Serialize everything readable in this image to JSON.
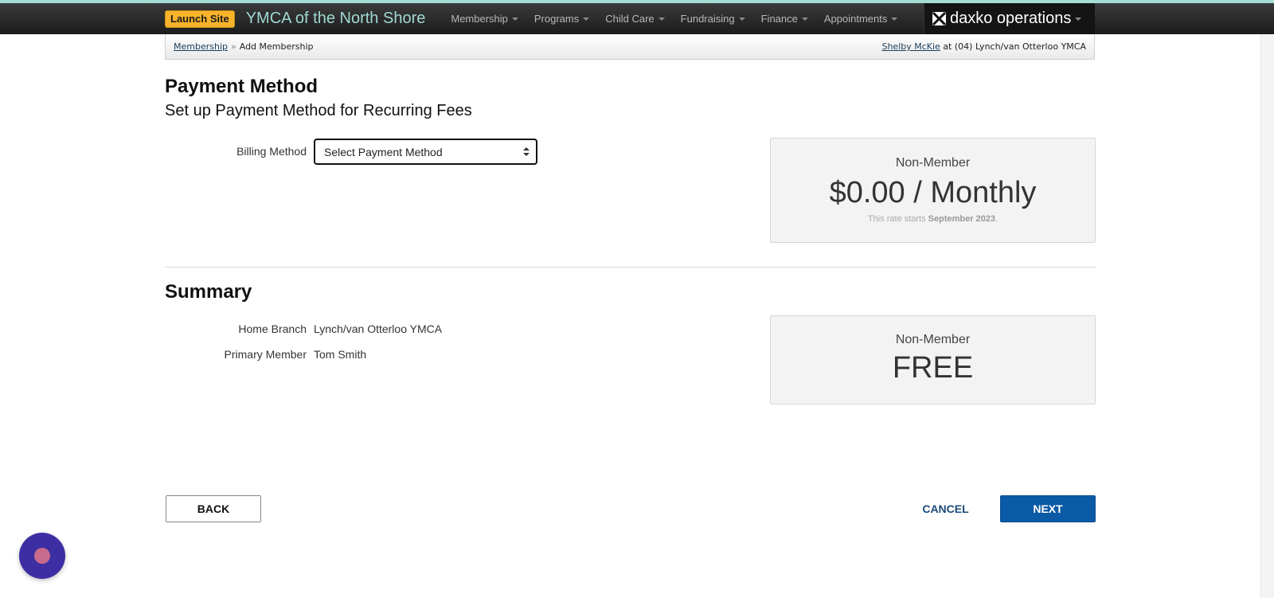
{
  "header": {
    "launch_site": "Launch Site",
    "org_name": "YMCA of the North Shore",
    "menu": [
      "Membership",
      "Programs",
      "Child Care",
      "Fundraising",
      "Finance",
      "Appointments"
    ],
    "brand": "daxko operations"
  },
  "breadcrumb": {
    "link": "Membership",
    "current": "Add Membership",
    "user": "Shelby McKie",
    "location": "at (04) Lynch/van Otterloo YMCA"
  },
  "payment": {
    "title": "Payment Method",
    "subtitle": "Set up Payment Method for Recurring Fees",
    "billing_label": "Billing Method",
    "select_value": "Select Payment Method"
  },
  "rate_card": {
    "name": "Non-Member",
    "price": "$0.00 / Monthly",
    "note_prefix": "This rate starts",
    "note_date": "September 2023",
    "note_suffix": "."
  },
  "summary": {
    "title": "Summary",
    "home_branch_label": "Home Branch",
    "home_branch_value": "Lynch/van Otterloo YMCA",
    "primary_member_label": "Primary Member",
    "primary_member_value": "Tom Smith"
  },
  "summary_card": {
    "name": "Non-Member",
    "price": "FREE"
  },
  "actions": {
    "back": "BACK",
    "cancel": "CANCEL",
    "next": "NEXT"
  },
  "colors": {
    "accent": "#0b5aa6",
    "launch": "#f7b32b",
    "org_name": "#9fd8d3",
    "chat": "#3d2fa3"
  }
}
